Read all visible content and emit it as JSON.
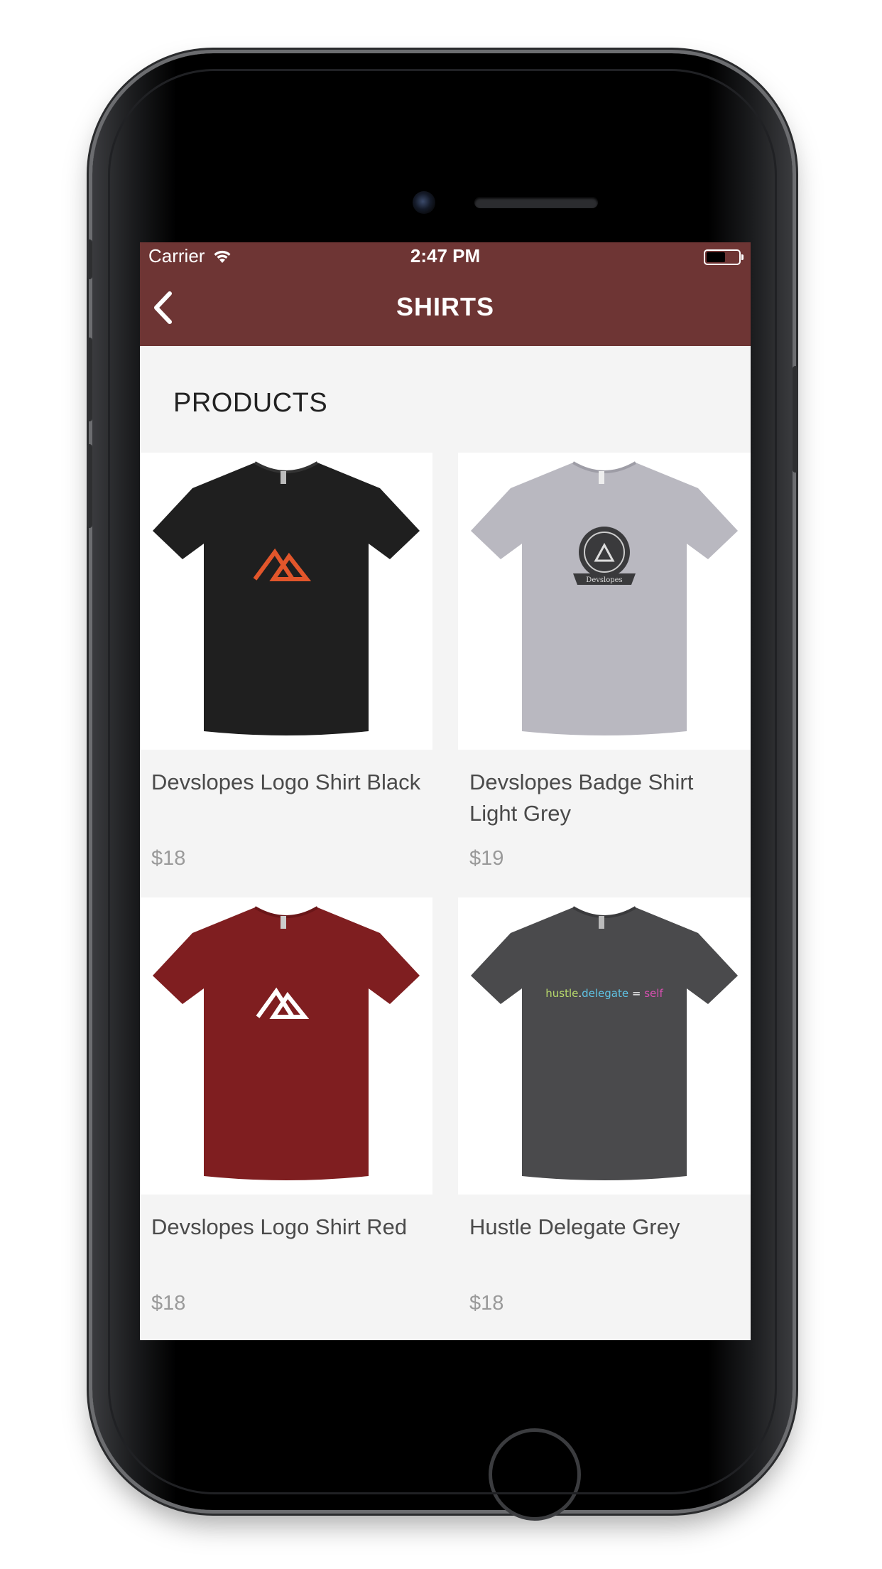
{
  "status_bar": {
    "carrier": "Carrier",
    "time": "2:47 PM",
    "battery_level": 0.6
  },
  "nav": {
    "title": "SHIRTS",
    "back_icon": "chevron-left-icon",
    "bar_color": "#6e3534"
  },
  "section": {
    "title": "PRODUCTS"
  },
  "products": [
    {
      "name": "Devslopes Logo Shirt Black",
      "price": "$18",
      "shirt_color": "#1f1f1f",
      "graphic": "orange-mountain-logo"
    },
    {
      "name": "Devslopes Badge Shirt Light Grey",
      "price": "$19",
      "shirt_color": "#b9b8c0",
      "graphic": "devslopes-badge",
      "graphic_text": "Devslopes"
    },
    {
      "name": "Devslopes Logo Shirt Red",
      "price": "$18",
      "shirt_color": "#7f1e20",
      "graphic": "white-mountain-logo"
    },
    {
      "name": "Hustle Delegate Grey",
      "price": "$18",
      "shirt_color": "#4a4a4c",
      "graphic": "hustle-delegate-text",
      "graphic_text": {
        "part1": "hustle",
        "dot": ".",
        "part2": "delegate",
        "eq": " = ",
        "part3": "self"
      }
    }
  ]
}
